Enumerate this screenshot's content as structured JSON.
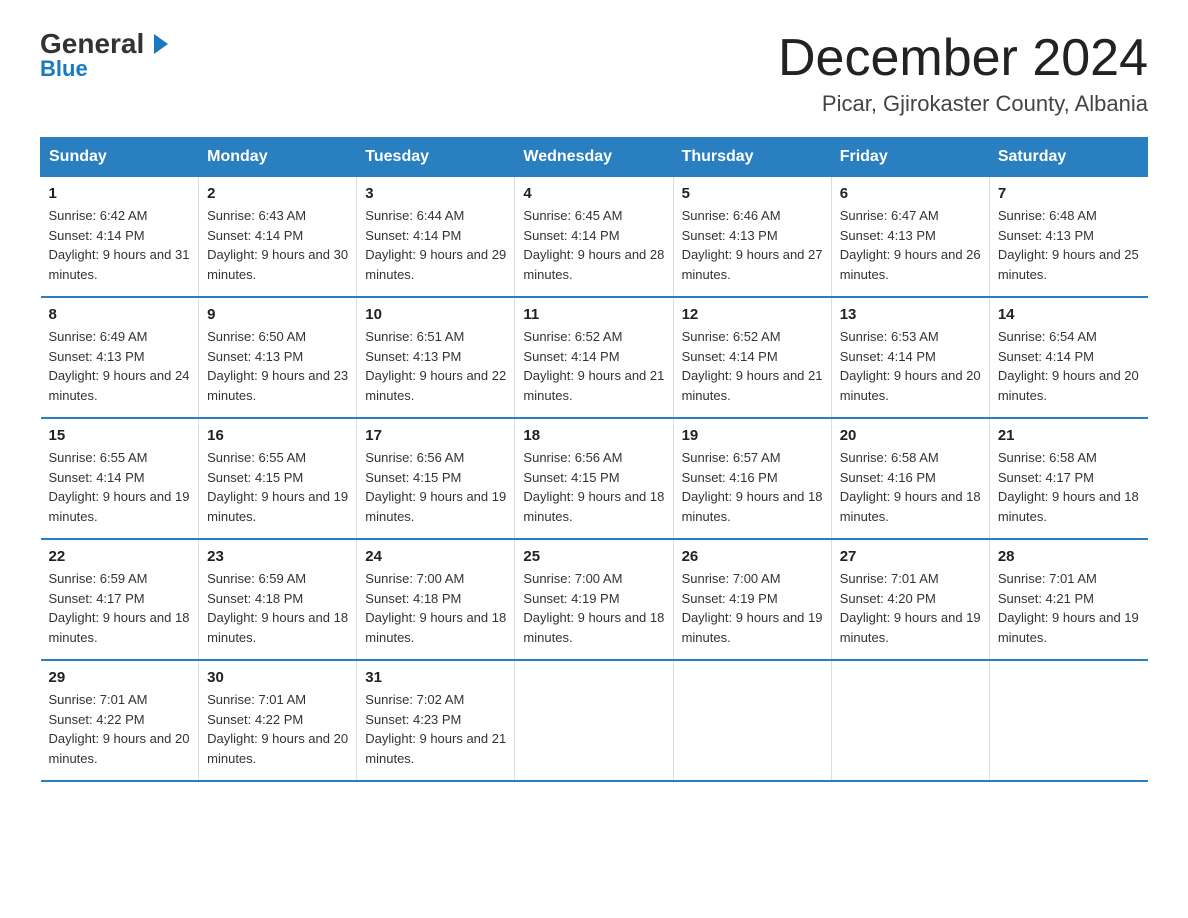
{
  "logo": {
    "name_black": "General",
    "arrow": "▶",
    "name_blue": "Blue"
  },
  "title": "December 2024",
  "subtitle": "Picar, Gjirokaster County, Albania",
  "days_of_week": [
    "Sunday",
    "Monday",
    "Tuesday",
    "Wednesday",
    "Thursday",
    "Friday",
    "Saturday"
  ],
  "weeks": [
    [
      {
        "day": "1",
        "sunrise": "6:42 AM",
        "sunset": "4:14 PM",
        "daylight": "9 hours and 31 minutes."
      },
      {
        "day": "2",
        "sunrise": "6:43 AM",
        "sunset": "4:14 PM",
        "daylight": "9 hours and 30 minutes."
      },
      {
        "day": "3",
        "sunrise": "6:44 AM",
        "sunset": "4:14 PM",
        "daylight": "9 hours and 29 minutes."
      },
      {
        "day": "4",
        "sunrise": "6:45 AM",
        "sunset": "4:14 PM",
        "daylight": "9 hours and 28 minutes."
      },
      {
        "day": "5",
        "sunrise": "6:46 AM",
        "sunset": "4:13 PM",
        "daylight": "9 hours and 27 minutes."
      },
      {
        "day": "6",
        "sunrise": "6:47 AM",
        "sunset": "4:13 PM",
        "daylight": "9 hours and 26 minutes."
      },
      {
        "day": "7",
        "sunrise": "6:48 AM",
        "sunset": "4:13 PM",
        "daylight": "9 hours and 25 minutes."
      }
    ],
    [
      {
        "day": "8",
        "sunrise": "6:49 AM",
        "sunset": "4:13 PM",
        "daylight": "9 hours and 24 minutes."
      },
      {
        "day": "9",
        "sunrise": "6:50 AM",
        "sunset": "4:13 PM",
        "daylight": "9 hours and 23 minutes."
      },
      {
        "day": "10",
        "sunrise": "6:51 AM",
        "sunset": "4:13 PM",
        "daylight": "9 hours and 22 minutes."
      },
      {
        "day": "11",
        "sunrise": "6:52 AM",
        "sunset": "4:14 PM",
        "daylight": "9 hours and 21 minutes."
      },
      {
        "day": "12",
        "sunrise": "6:52 AM",
        "sunset": "4:14 PM",
        "daylight": "9 hours and 21 minutes."
      },
      {
        "day": "13",
        "sunrise": "6:53 AM",
        "sunset": "4:14 PM",
        "daylight": "9 hours and 20 minutes."
      },
      {
        "day": "14",
        "sunrise": "6:54 AM",
        "sunset": "4:14 PM",
        "daylight": "9 hours and 20 minutes."
      }
    ],
    [
      {
        "day": "15",
        "sunrise": "6:55 AM",
        "sunset": "4:14 PM",
        "daylight": "9 hours and 19 minutes."
      },
      {
        "day": "16",
        "sunrise": "6:55 AM",
        "sunset": "4:15 PM",
        "daylight": "9 hours and 19 minutes."
      },
      {
        "day": "17",
        "sunrise": "6:56 AM",
        "sunset": "4:15 PM",
        "daylight": "9 hours and 19 minutes."
      },
      {
        "day": "18",
        "sunrise": "6:56 AM",
        "sunset": "4:15 PM",
        "daylight": "9 hours and 18 minutes."
      },
      {
        "day": "19",
        "sunrise": "6:57 AM",
        "sunset": "4:16 PM",
        "daylight": "9 hours and 18 minutes."
      },
      {
        "day": "20",
        "sunrise": "6:58 AM",
        "sunset": "4:16 PM",
        "daylight": "9 hours and 18 minutes."
      },
      {
        "day": "21",
        "sunrise": "6:58 AM",
        "sunset": "4:17 PM",
        "daylight": "9 hours and 18 minutes."
      }
    ],
    [
      {
        "day": "22",
        "sunrise": "6:59 AM",
        "sunset": "4:17 PM",
        "daylight": "9 hours and 18 minutes."
      },
      {
        "day": "23",
        "sunrise": "6:59 AM",
        "sunset": "4:18 PM",
        "daylight": "9 hours and 18 minutes."
      },
      {
        "day": "24",
        "sunrise": "7:00 AM",
        "sunset": "4:18 PM",
        "daylight": "9 hours and 18 minutes."
      },
      {
        "day": "25",
        "sunrise": "7:00 AM",
        "sunset": "4:19 PM",
        "daylight": "9 hours and 18 minutes."
      },
      {
        "day": "26",
        "sunrise": "7:00 AM",
        "sunset": "4:19 PM",
        "daylight": "9 hours and 19 minutes."
      },
      {
        "day": "27",
        "sunrise": "7:01 AM",
        "sunset": "4:20 PM",
        "daylight": "9 hours and 19 minutes."
      },
      {
        "day": "28",
        "sunrise": "7:01 AM",
        "sunset": "4:21 PM",
        "daylight": "9 hours and 19 minutes."
      }
    ],
    [
      {
        "day": "29",
        "sunrise": "7:01 AM",
        "sunset": "4:22 PM",
        "daylight": "9 hours and 20 minutes."
      },
      {
        "day": "30",
        "sunrise": "7:01 AM",
        "sunset": "4:22 PM",
        "daylight": "9 hours and 20 minutes."
      },
      {
        "day": "31",
        "sunrise": "7:02 AM",
        "sunset": "4:23 PM",
        "daylight": "9 hours and 21 minutes."
      },
      null,
      null,
      null,
      null
    ]
  ],
  "labels": {
    "sunrise": "Sunrise:",
    "sunset": "Sunset:",
    "daylight": "Daylight:"
  }
}
